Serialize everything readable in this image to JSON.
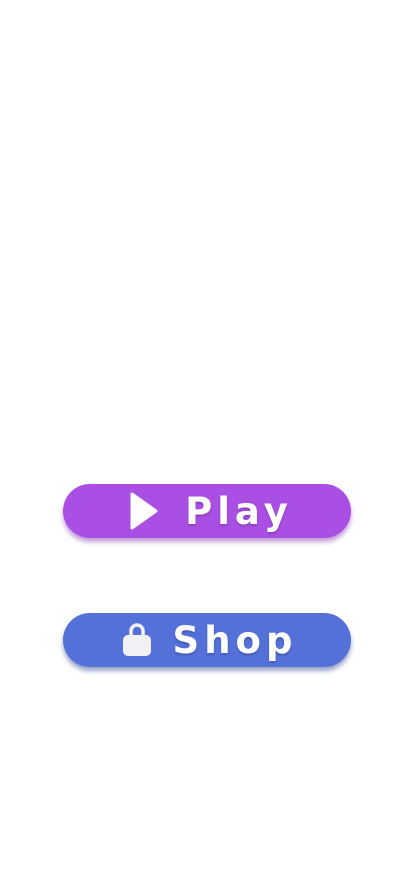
{
  "menu": {
    "play_label": "Play",
    "shop_label": "Shop"
  },
  "icons": {
    "play": "play-icon",
    "shop": "shopping-bag-icon"
  },
  "colors": {
    "background": "#ffffff",
    "play_button": "#a94fe3",
    "shop_button": "#5470d9",
    "label": "#ffffff",
    "shop_bag": "#f0f0f5"
  }
}
